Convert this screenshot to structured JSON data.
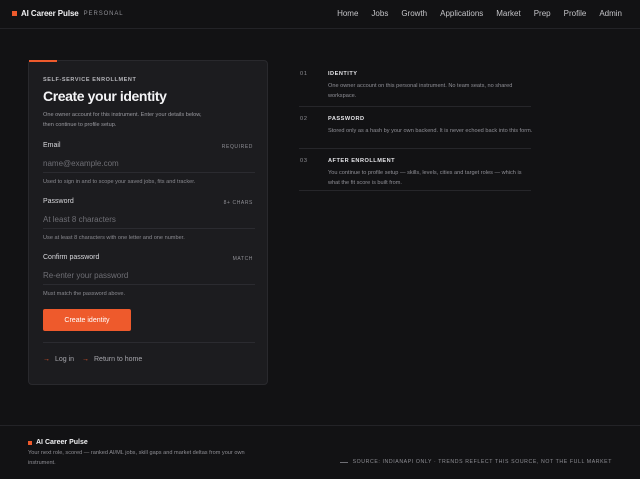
{
  "header": {
    "brand_name": "AI Career Pulse",
    "brand_tag": "PERSONAL",
    "nav": [
      "Home",
      "Jobs",
      "Growth",
      "Applications",
      "Market",
      "Prep",
      "Profile",
      "Admin"
    ]
  },
  "form": {
    "eyebrow": "SELF-SERVICE ENROLLMENT",
    "title": "Create your identity",
    "intro": "One owner account for this instrument. Enter your details below, then continue to profile setup.",
    "email": {
      "label": "Email",
      "tag": "REQUIRED",
      "placeholder": "name@example.com",
      "value": "",
      "help": "Used to sign in and to scope your saved jobs, fits and tracker."
    },
    "password": {
      "label": "Password",
      "tag": "8+ CHARS",
      "placeholder": "At least 8 characters",
      "value": "",
      "help": "Use at least 8 characters with one letter and one number."
    },
    "confirm": {
      "label": "Confirm password",
      "tag": "MATCH",
      "placeholder": "Re-enter your password",
      "value": "",
      "help": "Must match the password above."
    },
    "submit_label": "Create identity",
    "login_label": "Log in",
    "home_label": "Return to home"
  },
  "steps": [
    {
      "num": "01",
      "title": "IDENTITY",
      "desc": "One owner account on this personal instrument. No team seats, no shared workspace."
    },
    {
      "num": "02",
      "title": "PASSWORD",
      "desc": "Stored only as a hash by your own backend. It is never echoed back into this form."
    },
    {
      "num": "03",
      "title": "AFTER ENROLLMENT",
      "desc": "You continue to profile setup — skills, levels, cities and target roles — which is what the fit score is built from."
    }
  ],
  "footer": {
    "brand_name": "AI Career Pulse",
    "tagline": "Your next role, scored — ranked AI/ML jobs, skill gaps and market deltas from your own instrument.",
    "source": "SOURCE: INDIANAPI ONLY · TRENDS REFLECT THIS SOURCE, NOT THE FULL MARKET"
  },
  "colors": {
    "accent": "#ee5a2c",
    "background": "#121214",
    "card": "#1c1c1f"
  }
}
